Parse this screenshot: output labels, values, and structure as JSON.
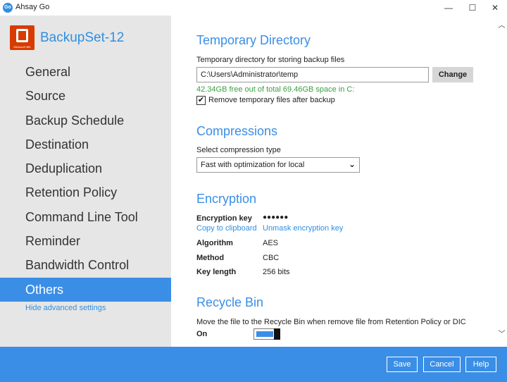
{
  "window": {
    "app_icon_text": "Go",
    "title": "Ahsay Go",
    "minimize": "—",
    "maximize": "☐",
    "close": "✕"
  },
  "sidebar": {
    "logo_caption": "Microsoft 365",
    "set_name": "BackupSet-12",
    "items": [
      {
        "label": "General"
      },
      {
        "label": "Source"
      },
      {
        "label": "Backup Schedule"
      },
      {
        "label": "Destination"
      },
      {
        "label": "Deduplication"
      },
      {
        "label": "Retention Policy"
      },
      {
        "label": "Command Line Tool"
      },
      {
        "label": "Reminder"
      },
      {
        "label": "Bandwidth Control"
      },
      {
        "label": "Others"
      }
    ],
    "active": "Others",
    "hide_advanced": "Hide advanced settings"
  },
  "temp_dir": {
    "title": "Temporary Directory",
    "label": "Temporary directory for storing backup files",
    "path": "C:\\Users\\Administrator\\temp",
    "change_label": "Change",
    "free_space": "42.34GB free out of total 69.46GB space in C:",
    "remove_checked": true,
    "remove_label": "Remove temporary files after backup"
  },
  "compressions": {
    "title": "Compressions",
    "label": "Select compression type",
    "selected": "Fast with optimization for local"
  },
  "encryption": {
    "title": "Encryption",
    "key_label": "Encryption key",
    "key_value": "●●●●●●",
    "copy_link": "Copy to clipboard",
    "unmask_link": "Unmask encryption key",
    "algorithm_label": "Algorithm",
    "algorithm_value": "AES",
    "method_label": "Method",
    "method_value": "CBC",
    "key_length_label": "Key length",
    "key_length_value": "256 bits"
  },
  "recycle_bin": {
    "title": "Recycle Bin",
    "label": "Move the file to the Recycle Bin when remove file from Retention Policy or DIC",
    "state": "On",
    "enabled": true
  },
  "footer": {
    "save": "Save",
    "cancel": "Cancel",
    "help": "Help"
  },
  "colors": {
    "accent": "#3a8ee6",
    "sidebar_bg": "#e6e6e6",
    "success_text": "#3aa140",
    "logo": "#d83b01"
  }
}
